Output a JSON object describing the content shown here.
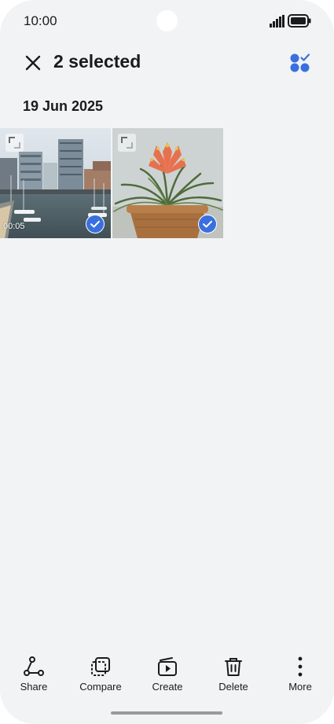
{
  "status_bar": {
    "time": "10:00",
    "signal_icon": "signal-icon",
    "battery_icon": "battery-icon"
  },
  "app_bar": {
    "title": "2 selected",
    "close_icon": "close-icon",
    "select_all_icon": "select-all-icon"
  },
  "date_header": "19 Jun 2025",
  "items": [
    {
      "kind": "video",
      "subject": "harbour-buildings",
      "duration": "00:05",
      "selected": true
    },
    {
      "kind": "photo",
      "subject": "potted-bromeliad",
      "selected": true
    }
  ],
  "bottom_bar": {
    "actions": [
      {
        "label": "Share",
        "icon": "share-icon"
      },
      {
        "label": "Compare",
        "icon": "compare-icon"
      },
      {
        "label": "Create",
        "icon": "create-icon"
      },
      {
        "label": "Delete",
        "icon": "trash-icon"
      },
      {
        "label": "More",
        "icon": "more-icon"
      }
    ]
  },
  "colors": {
    "accent": "#3a6fe0",
    "background": "#f2f3f5",
    "text": "#1b1b1b"
  }
}
